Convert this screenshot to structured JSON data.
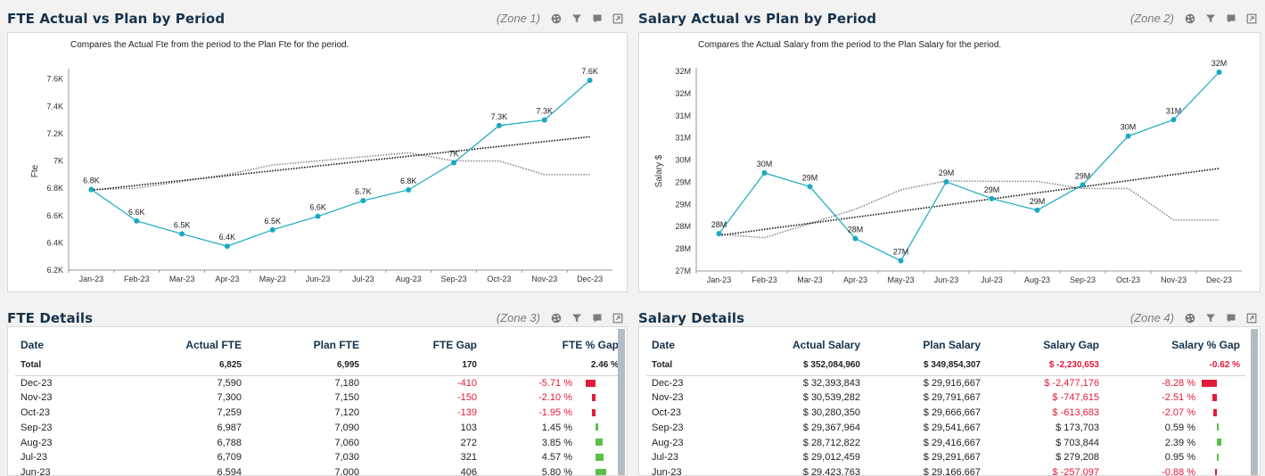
{
  "zones": [
    {
      "title": "FTE Actual vs Plan by Period",
      "label": "(Zone 1)"
    },
    {
      "title": "Salary Actual vs Plan by Period",
      "label": "(Zone 2)"
    },
    {
      "title": "FTE Details",
      "label": "(Zone 3)"
    },
    {
      "title": "Salary Details",
      "label": "(Zone 4)"
    }
  ],
  "icons": [
    "palette-icon",
    "filter-icon",
    "comment-icon",
    "export-icon"
  ],
  "colors": {
    "actual": "#1aa9c1",
    "plan": "#8a8a8a",
    "trend": "#111111",
    "negative": "#e31a3a",
    "positive": "#5bbf4a",
    "title": "#17324a"
  },
  "chart_data": [
    {
      "type": "line",
      "subtitle": "Compares the Actual Fte from the period to the Plan Fte for the period.",
      "ylabel": "Fte",
      "x": [
        "Jan-23",
        "Feb-23",
        "Mar-23",
        "Apr-23",
        "May-23",
        "Jun-23",
        "Jul-23",
        "Aug-23",
        "Sep-23",
        "Oct-23",
        "Nov-23",
        "Dec-23"
      ],
      "yticks": [
        "6.2K",
        "6.4K",
        "6.6K",
        "6.8K",
        "7K",
        "7.2K",
        "7.4K",
        "7.6K"
      ],
      "ytick_values": [
        6200,
        6400,
        6600,
        6800,
        7000,
        7200,
        7400,
        7600
      ],
      "ylim": [
        6200,
        7650
      ],
      "series": [
        {
          "values": [
            6790,
            6560,
            6465,
            6375,
            6495,
            6594,
            6709,
            6788,
            6987,
            7259,
            7300,
            7590
          ],
          "labels": [
            "6.8K",
            "6.6K",
            "6.5K",
            "6.4K",
            "6.5K",
            "6.6K",
            "6.7K",
            "6.8K",
            "7K",
            "7.3K",
            "7.3K",
            "7.6K"
          ]
        },
        {
          "values": [
            6790,
            6800,
            6850,
            6900,
            6970,
            7000,
            7030,
            7060,
            7000,
            7000,
            6900,
            6900
          ]
        },
        {
          "values": [
            6785,
            7177
          ]
        }
      ]
    },
    {
      "type": "line",
      "subtitle": "Compares the Actual Salary from the period to the Plan Salary for the period.",
      "ylabel": "Salary $",
      "x": [
        "Jan-23",
        "Feb-23",
        "Mar-23",
        "Apr-23",
        "May-23",
        "Jun-23",
        "Jul-23",
        "Aug-23",
        "Sep-23",
        "Oct-23",
        "Nov-23",
        "Dec-23"
      ],
      "yticks": [
        "27M",
        "28M",
        "28M",
        "29M",
        "29M",
        "30M",
        "31M",
        "31M",
        "32M",
        "32M"
      ],
      "ytick_values": [
        27.0,
        27.5,
        28.0,
        28.5,
        29.0,
        29.5,
        30.0,
        30.5,
        31.0,
        31.5
      ],
      "ylim": [
        27.0,
        31.5
      ],
      "series": [
        {
          "values": [
            27.84,
            29.21,
            28.9,
            27.73,
            27.23,
            29.01,
            28.63,
            28.37,
            28.94,
            30.04,
            30.41,
            31.48
          ],
          "labels": [
            "28M",
            "30M",
            "29M",
            "28M",
            "27M",
            "29M",
            "29M",
            "29M",
            "29M",
            "30M",
            "31M",
            "32M"
          ]
        },
        {
          "values": [
            27.83,
            27.75,
            28.07,
            28.39,
            28.83,
            29.03,
            29.02,
            29.02,
            28.86,
            28.86,
            28.15,
            28.15
          ]
        },
        {
          "values": [
            27.8,
            29.31
          ]
        }
      ]
    }
  ],
  "fte_table": {
    "headers": [
      "Date",
      "Actual FTE",
      "Plan FTE",
      "FTE Gap",
      "FTE % Gap"
    ],
    "total": [
      "Total",
      "6,825",
      "6,995",
      "170",
      "2.46 %"
    ],
    "rows": [
      {
        "cells": [
          "Dec-23",
          "7,590",
          "7,180",
          "-410",
          "-5.71 %"
        ],
        "gap_pct": -5.71
      },
      {
        "cells": [
          "Nov-23",
          "7,300",
          "7,150",
          "-150",
          "-2.10 %"
        ],
        "gap_pct": -2.1
      },
      {
        "cells": [
          "Oct-23",
          "7,259",
          "7,120",
          "-139",
          "-1.95 %"
        ],
        "gap_pct": -1.95
      },
      {
        "cells": [
          "Sep-23",
          "6,987",
          "7,090",
          "103",
          "1.45 %"
        ],
        "gap_pct": 1.45
      },
      {
        "cells": [
          "Aug-23",
          "6,788",
          "7,060",
          "272",
          "3.85 %"
        ],
        "gap_pct": 3.85
      },
      {
        "cells": [
          "Jul-23",
          "6,709",
          "7,030",
          "321",
          "4.57 %"
        ],
        "gap_pct": 4.57
      },
      {
        "cells": [
          "Jun-23",
          "6,594",
          "7,000",
          "406",
          "5.80 %"
        ],
        "gap_pct": 5.8
      }
    ]
  },
  "salary_table": {
    "headers": [
      "Date",
      "Actual Salary",
      "Plan Salary",
      "Salary Gap",
      "Salary % Gap"
    ],
    "total": [
      "Total",
      "$ 352,084,960",
      "$ 349,854,307",
      "$ -2,230,653",
      "-0.62 %"
    ],
    "rows": [
      {
        "cells": [
          "Dec-23",
          "$ 32,393,843",
          "$ 29,916,667",
          "$ -2,477,176",
          "-8.28 %"
        ],
        "gap_pct": -8.28
      },
      {
        "cells": [
          "Nov-23",
          "$ 30,539,282",
          "$ 29,791,667",
          "$ -747,615",
          "-2.51 %"
        ],
        "gap_pct": -2.51
      },
      {
        "cells": [
          "Oct-23",
          "$ 30,280,350",
          "$ 29,666,667",
          "$ -613,683",
          "-2.07 %"
        ],
        "gap_pct": -2.07
      },
      {
        "cells": [
          "Sep-23",
          "$ 29,367,964",
          "$ 29,541,667",
          "$ 173,703",
          "0.59 %"
        ],
        "gap_pct": 0.59
      },
      {
        "cells": [
          "Aug-23",
          "$ 28,712,822",
          "$ 29,416,667",
          "$ 703,844",
          "2.39 %"
        ],
        "gap_pct": 2.39
      },
      {
        "cells": [
          "Jul-23",
          "$ 29,012,459",
          "$ 29,291,667",
          "$ 279,208",
          "0.95 %"
        ],
        "gap_pct": 0.95
      },
      {
        "cells": [
          "Jun-23",
          "$ 29,423,763",
          "$ 29,166,667",
          "$ -257,097",
          "-0.88 %"
        ],
        "gap_pct": -0.88
      }
    ]
  }
}
